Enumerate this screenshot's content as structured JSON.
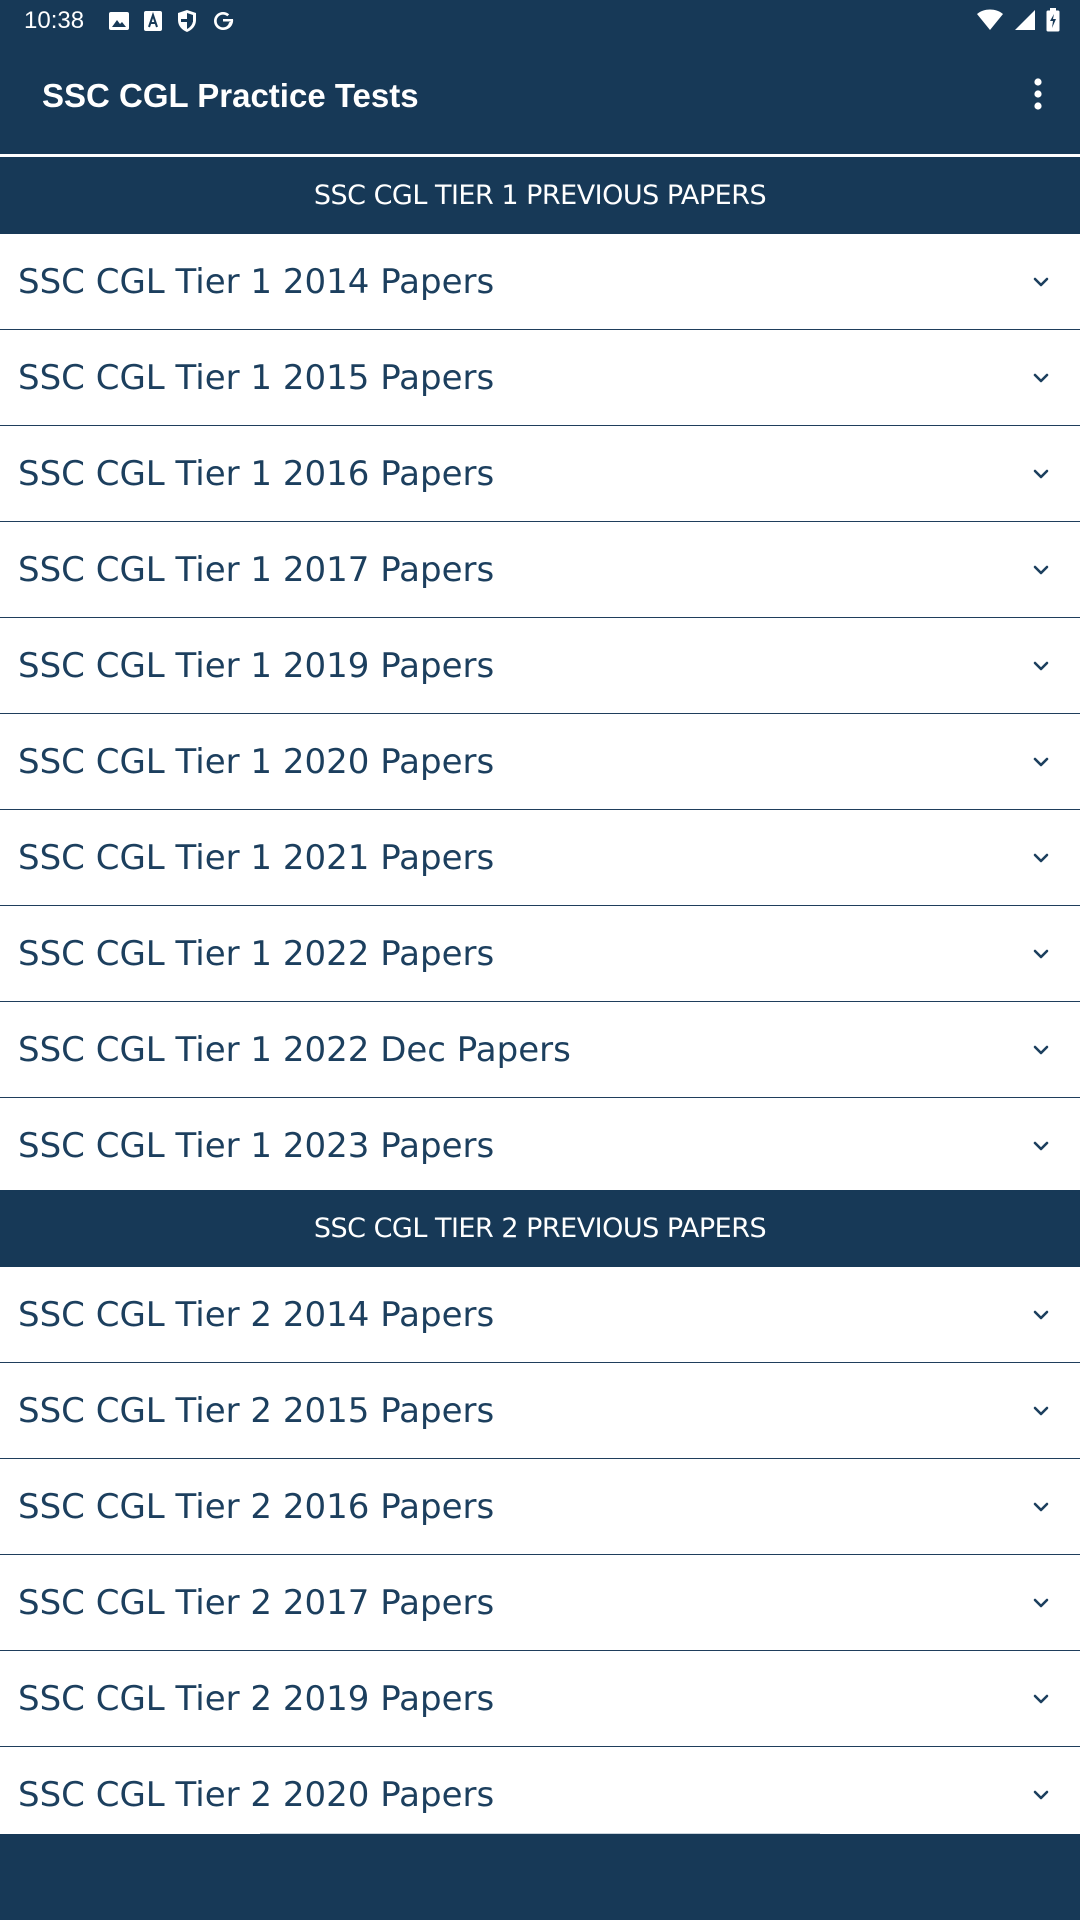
{
  "status_bar": {
    "time": "10:38",
    "left_icons": [
      "image-icon",
      "text-a-icon",
      "shield-icon",
      "google-icon"
    ],
    "right_icons": [
      "wifi-icon",
      "signal-icon",
      "battery-icon"
    ]
  },
  "app_bar": {
    "title": "SSC CGL Practice Tests",
    "overflow_icon": "more-vert-icon"
  },
  "sections": [
    {
      "header": "SSC CGL TIER 1 PREVIOUS PAPERS",
      "items": [
        "SSC CGL Tier 1 2014 Papers",
        "SSC CGL Tier 1 2015 Papers",
        "SSC CGL Tier 1 2016 Papers",
        "SSC CGL Tier 1 2017 Papers",
        "SSC CGL Tier 1 2019 Papers",
        "SSC CGL Tier 1 2020 Papers",
        "SSC CGL Tier 1 2021 Papers",
        "SSC CGL Tier 1 2022 Papers",
        "SSC CGL Tier 1 2022 Dec Papers",
        "SSC CGL Tier 1 2023 Papers"
      ]
    },
    {
      "header": "SSC CGL TIER 2 PREVIOUS PAPERS",
      "items": [
        "SSC CGL Tier 2 2014 Papers",
        "SSC CGL Tier 2 2015 Papers",
        "SSC CGL Tier 2 2016 Papers",
        "SSC CGL Tier 2 2017 Papers",
        "SSC CGL Tier 2 2019 Papers",
        "SSC CGL Tier 2 2020 Papers"
      ]
    }
  ],
  "colors": {
    "primary": "#173957",
    "item_text": "#1c3f5e",
    "divider": "#1f3e5c"
  }
}
